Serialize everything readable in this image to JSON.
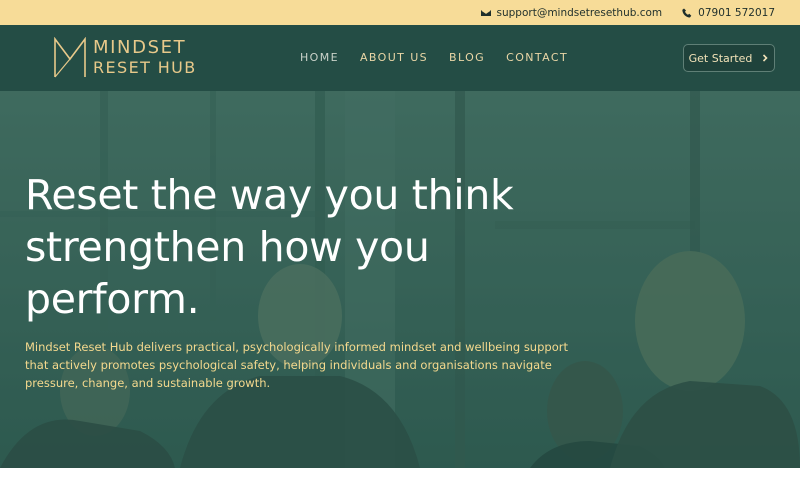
{
  "topbar": {
    "email": "support@mindsetresethub.com",
    "phone": "07901 572017",
    "email_icon": "envelope-icon",
    "phone_icon": "phone-icon"
  },
  "logo": {
    "line1": "MINDSET",
    "line2": "RESET HUB",
    "mark_icon": "m-monogram-icon"
  },
  "nav": {
    "items": [
      {
        "label": "HOME",
        "active": true
      },
      {
        "label": "ABOUT US",
        "active": false
      },
      {
        "label": "BLOG",
        "active": false
      },
      {
        "label": "CONTACT",
        "active": false
      }
    ],
    "cta_label": "Get Started",
    "cta_icon": "chevron-right-icon"
  },
  "hero": {
    "headline_lines": [
      "Reset the way you think",
      "strengthen how you",
      "perform."
    ],
    "description": "Mindset Reset Hub delivers practical, psychologically informed mindset and wellbeing support that actively promotes psychological safety, helping individuals and organisations navigate pressure, change, and sustainable growth."
  },
  "colors": {
    "topbar_bg": "#f7dc98",
    "header_bg": "#244d45",
    "hero_overlay": "#3c675c",
    "accent_gold": "#e8c98a",
    "description_text": "#f4d98e"
  }
}
